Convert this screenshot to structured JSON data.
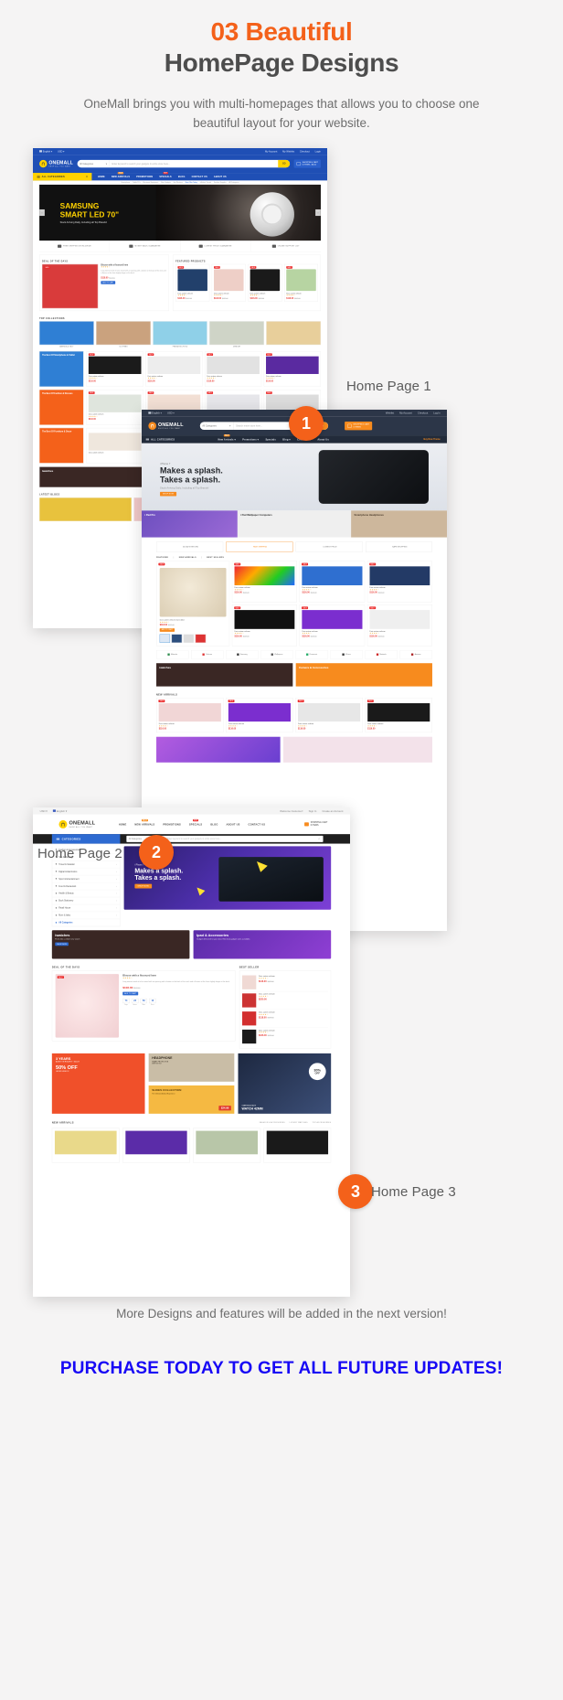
{
  "header": {
    "title_line1": "03 Beautiful",
    "title_line2": "HomePage Designs",
    "subtitle": "OneMall brings you with multi-homepages that allows you to choose one beautiful layout for your website.",
    "accent_color": "#f4611a",
    "title_color": "#4d4d4d"
  },
  "steps": [
    {
      "number": "1",
      "label": "Home Page 1"
    },
    {
      "number": "2",
      "label": "Home Page 2"
    },
    {
      "number": "3",
      "label": "Home Page 3"
    }
  ],
  "footer": {
    "note": "More Designs and features will be added in the next version!",
    "cta": "PURCHASE TODAY TO GET ALL FUTURE UPDATES!",
    "cta_color": "#1708f5"
  },
  "shot1": {
    "theme_color": "#1f4fb5",
    "accent_color": "#ffd200",
    "topbar": {
      "language": "English",
      "currency": "USD",
      "links": [
        "My Account",
        "My Wishlist",
        "Checkout",
        "Login"
      ]
    },
    "brand": {
      "name": "ONEMALL",
      "tagline": "SHOP ALL YOU WANT"
    },
    "search": {
      "category": "All Categories",
      "placeholder": "Enter keyword to search your gadgets in entire store here...",
      "button": "GO"
    },
    "cart": {
      "line1": "SHOPPING CART",
      "line2": "0 ITEMS - $0.00"
    },
    "nav": {
      "all_categories": "ALL CATEGORIES",
      "items": [
        {
          "label": "HOME",
          "tag": ""
        },
        {
          "label": "NEW ARRIVALS",
          "tag": "SALE"
        },
        {
          "label": "PROMOTIONS",
          "tag": ""
        },
        {
          "label": "SPECIALS",
          "tag": "HOT"
        },
        {
          "label": "BLOG",
          "tag": ""
        },
        {
          "label": "CONTACT US",
          "tag": ""
        },
        {
          "label": "ABOUT US",
          "tag": ""
        }
      ]
    },
    "breadcrumbs": [
      "Smartphone",
      "Tablet PCs",
      "Electronic Equipment",
      "New Gadgets",
      "Hot Wireless",
      "Best Offer Today",
      "eMarket Trends",
      "Fashion Supplies",
      "All Categories"
    ],
    "hero": {
      "title_line1": "SAMSUNG",
      "title_line2": "SMART LED 70\"",
      "sub": "Stock Arriving Daily, Including all Top Brands!"
    },
    "services": [
      "FREE SHIPPING WORLDWIDE",
      "MONEY BACK GUARANTEE",
      "LOWEST PRICE GUARANTEE",
      "ONLINE SUPPORT 24/7"
    ],
    "sections": {
      "deal": "DEAL OF THE DAYS",
      "featured": "FEATURED PRODUCTS",
      "top_categories": "TOP COLLECTIONS",
      "latest_blogs": "LATEST BLOGS"
    },
    "deal_product": {
      "name": "Blouse with a flounced hem",
      "price": "$118.00",
      "old": "$127.00",
      "button": "ADD TO CART"
    },
    "product_name": "Duis autem veleum",
    "product_price": "$116.00",
    "product_old": "$127.00",
    "categories_row": [
      "AMERICA & ONLY",
      "CLOTHING",
      "FINE ARTS & FOOD",
      "JEWELRY"
    ],
    "promo_titles": [
      "The Best Of Smartphone & Tablet",
      "The Best Of Fashion & Dresses",
      "The Best Of Furniture & Decor"
    ]
  },
  "shot2": {
    "theme_color": "#2c3648",
    "accent_color": "#f78b1e",
    "topbar": {
      "language": "English",
      "currency": "USD",
      "links": [
        "Wishlist",
        "My Account",
        "Checkout",
        "Log In"
      ]
    },
    "brand": {
      "name": "ONEMALL",
      "tagline": "SHOP ALL YOU WANT"
    },
    "search": {
      "category": "All Categories",
      "placeholder": "Search entire store here...",
      "button": "GO"
    },
    "cart": {
      "line1": "SHOPPING CART",
      "line2": "0 ITEMS"
    },
    "nav": {
      "all_categories": "ALL CATEGORIES",
      "items": [
        {
          "label": "New Arrivals",
          "tag": "SALE"
        },
        {
          "label": "Promotions",
          "tag": ""
        },
        {
          "label": "Specials",
          "tag": ""
        },
        {
          "label": "Blog",
          "tag": ""
        },
        {
          "label": "Contact Us",
          "tag": ""
        },
        {
          "label": "About Us",
          "tag": ""
        }
      ],
      "buy_button": "Buy Now Theme"
    },
    "hero": {
      "eyebrow": "i Phone 7",
      "title_line1": "Makes a splash.",
      "title_line2": "Takes a splash.",
      "sub": "Stock Arriving Daily, Including all Top Brands!",
      "button": "SHOP NOW"
    },
    "banners": [
      "i Pad Pro",
      "i Pad Wallpaper Computers",
      "Smartphone Headphones"
    ],
    "services": [
      "30 DAYS RETURN",
      "FAST SHIPPING",
      "LOWEST PRICE",
      "SAFE SHOPPING"
    ],
    "tabs": [
      "FEATURED",
      "NEW ARRIVALS",
      "BEST SELLERS"
    ],
    "feature_product": {
      "name": "Duis autem veleum iriure dolor",
      "price": "$118.00",
      "old": "$127.00",
      "button": "ADD TO CART"
    },
    "product_name": "Duis autem veleum",
    "product_price": "$116.00",
    "product_old": "$127.00",
    "brands": [
      "Motorola",
      "Telecom",
      "Samsung",
      "Wallpapers",
      "Panasonic",
      "iPhone",
      "Motorola",
      "Amazon"
    ],
    "promo_banners": [
      "iwatches",
      "Camera & Accessories"
    ],
    "section_new": "NEW ARRIVALS"
  },
  "shot3": {
    "theme_color": "#2d6ad1",
    "accent_color": "#f78b1e",
    "topbar": {
      "currency": "USD",
      "language": "English",
      "welcome": "Welcome Customer!",
      "links": [
        "Sign In",
        "Create an Account"
      ]
    },
    "brand": {
      "name": "ONEMALL",
      "tagline": "SHOP ALL YOU WANT"
    },
    "nav": {
      "items": [
        {
          "label": "HOME",
          "tag": ""
        },
        {
          "label": "NEW ARRIVALS",
          "tag": "SALE"
        },
        {
          "label": "PROMOTIONS",
          "tag": ""
        },
        {
          "label": "SPECIALS",
          "tag": "HOT"
        },
        {
          "label": "BLOG",
          "tag": ""
        },
        {
          "label": "ABOUT US",
          "tag": ""
        },
        {
          "label": "CONTACT US",
          "tag": ""
        }
      ]
    },
    "cart": {
      "line1": "SHOPPING CART",
      "line2": "0 ITEMS"
    },
    "sidebar": {
      "title": "CATEGORIES",
      "items": [
        "Fashion & Accessories",
        "Spa & Massage",
        "Travel & Vacation",
        "Digital & Electronics",
        "Sport & Entertainment",
        "Food & Restaurant",
        "Health & Beauty",
        "Book Stationery",
        "Retail House",
        "Mom & baby",
        "All Categories"
      ]
    },
    "search": {
      "category": "All Categories",
      "placeholder": "Enter keyword to search your gadgets in entire store here..."
    },
    "hero": {
      "eyebrow": "i Phone 7",
      "title_line1": "Makes a splash.",
      "title_line2": "Takes a splash.",
      "button": "SHOP NOW"
    },
    "promo_banners": [
      {
        "title": "iwatches",
        "sub": "Feels like a whole new watch",
        "button": "SHOP NOW"
      },
      {
        "title": "Ipad & Accessories",
        "sub": "Gadget delivered to your door. Electrical gadget sales available."
      }
    ],
    "sections": {
      "deal": "DEAL OF THE DAYS",
      "best_seller": "BEST SELLER",
      "new_arrivals": "NEW ARRIVALS"
    },
    "deal_product": {
      "name": "Blouse with a flounced hem",
      "price": "$118.00",
      "old": "$127.00",
      "button": "ADD TO CART"
    },
    "countdown": {
      "values": [
        "74",
        "23",
        "59",
        "10"
      ],
      "labels": [
        "Days",
        "Hours",
        "Mins",
        "Secs"
      ]
    },
    "best_sellers": [
      {
        "name": "Duis autem veleum",
        "price": "$116.00",
        "old": "$127.00"
      },
      {
        "name": "Duis autem veleum",
        "price": "$220.00",
        "old": ""
      },
      {
        "name": "Duis autem veleum",
        "price": "$118.00",
        "old": "$127.00"
      },
      {
        "name": "Duis autem veleum",
        "price": "$106.00",
        "old": "$127.00"
      }
    ],
    "promo_tiles": [
      {
        "line1": "3 YEARS",
        "line2": "ANNIVERSARY SALE",
        "line3": "50% OFF",
        "line4": "LADIES FASHION"
      },
      {
        "line1": "HEADPHONE",
        "line2": "SMART PROTECTION",
        "line3": "WITH STYLE"
      },
      {
        "line1": "30%",
        "line2": "OFF",
        "line3": "STARTING AT $279",
        "line4": "WATCH 42MM"
      },
      {
        "line1": "SHOES COLLECTION",
        "line2": "The Ultimate Android Experience",
        "line3": "$24.99"
      }
    ],
    "arrival_tabs": [
      "FASHION & ACCESSORIES",
      "LUXURY WATCHES",
      "TOP ACCESSORIES"
    ]
  }
}
